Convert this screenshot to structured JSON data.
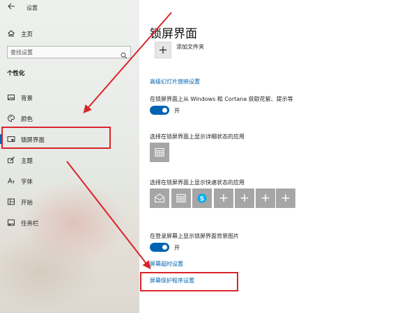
{
  "window": {
    "back_icon": "back-arrow-icon",
    "title": "设置"
  },
  "sidebar": {
    "home": {
      "label": "主页",
      "icon": "home-icon"
    },
    "search": {
      "placeholder": "查找设置",
      "icon": "search-icon"
    },
    "section": "个性化",
    "items": [
      {
        "label": "背景",
        "icon": "picture-icon",
        "active": false
      },
      {
        "label": "颜色",
        "icon": "palette-icon",
        "active": false
      },
      {
        "label": "锁屏界面",
        "icon": "lock-screen-icon",
        "active": true
      },
      {
        "label": "主题",
        "icon": "brush-icon",
        "active": false
      },
      {
        "label": "字体",
        "icon": "font-icon",
        "active": false
      },
      {
        "label": "开始",
        "icon": "start-grid-icon",
        "active": false
      },
      {
        "label": "任务栏",
        "icon": "taskbar-icon",
        "active": false
      }
    ]
  },
  "main": {
    "title": "锁屏界面",
    "add_folder": {
      "plus": "+",
      "label": "添加文件夹"
    },
    "slideshow_link": "高级幻灯片放映设置",
    "spotlight": {
      "label": "在锁屏界面上从 Windows 和 Cortana 获取花絮、提示等",
      "state": "开",
      "on": true
    },
    "detail_status": {
      "label": "选择在锁屏界面上显示详细状态的应用",
      "app_icon": "calendar-icon"
    },
    "quick_status": {
      "label": "选择在锁屏界面上显示快速状态的应用",
      "tiles": [
        {
          "icon": "mail-icon",
          "plus": ""
        },
        {
          "icon": "calendar-icon",
          "plus": ""
        },
        {
          "icon": "skype-icon",
          "plus": ""
        },
        {
          "icon": "plus-icon",
          "plus": "+"
        },
        {
          "icon": "plus-icon",
          "plus": "+"
        },
        {
          "icon": "plus-icon",
          "plus": "+"
        },
        {
          "icon": "plus-icon",
          "plus": "+"
        }
      ]
    },
    "signin_background": {
      "label": "在登录屏幕上显示锁屏界面背景图片",
      "state": "开",
      "on": true
    },
    "screen_timeout_link": "屏幕超时设置",
    "screen_saver_link": "屏幕保护程序设置"
  },
  "colors": {
    "accent": "#0063b1",
    "annotation": "#d9242a",
    "tile": "#a6a6a6"
  }
}
